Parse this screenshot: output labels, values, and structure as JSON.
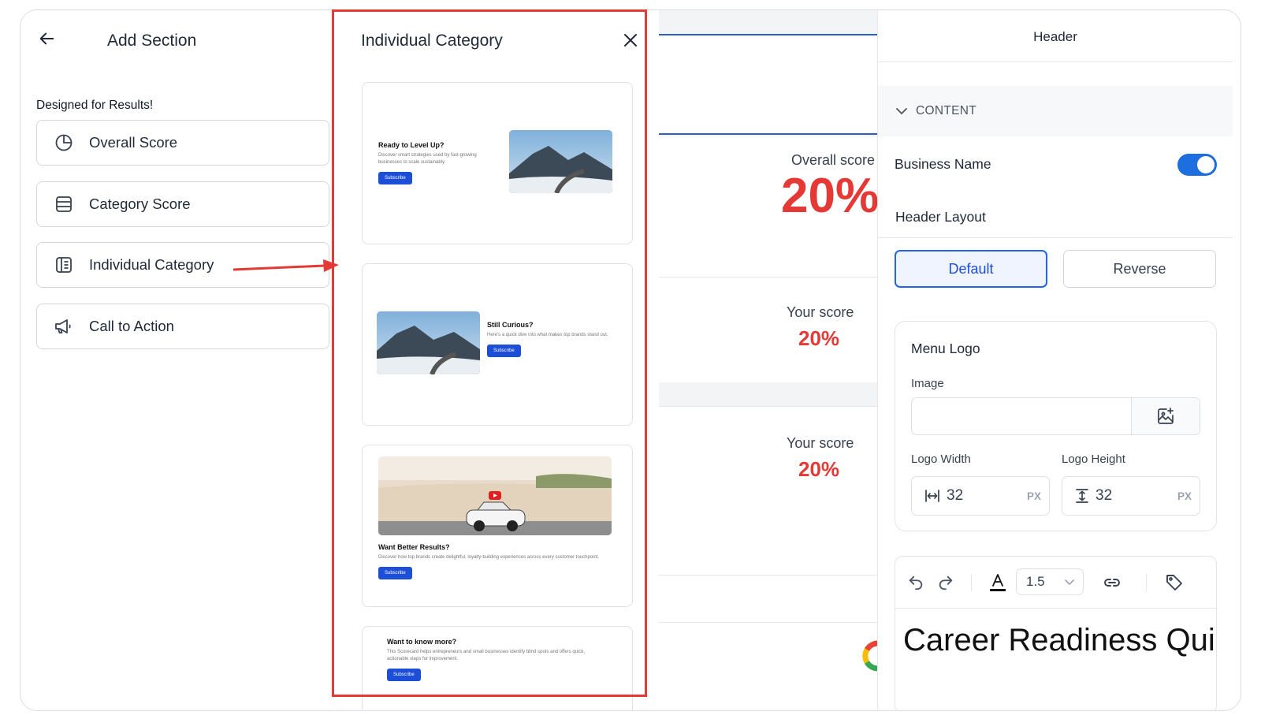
{
  "left_panel": {
    "title": "Add Section",
    "subtitle": "Designed for Results!",
    "items": [
      {
        "label": "Overall Score",
        "icon": "pie-chart-icon"
      },
      {
        "label": "Category Score",
        "icon": "list-icon"
      },
      {
        "label": "Individual Category",
        "icon": "book-icon"
      },
      {
        "label": "Call to Action",
        "icon": "megaphone-icon"
      }
    ]
  },
  "middle_panel": {
    "title": "Individual Category",
    "cards": [
      {
        "heading": "Ready to Level Up?",
        "text": "Discover smart strategies used by fast-growing businesses to scale sustainably.",
        "button": "Subscribe"
      },
      {
        "heading": "Still Curious?",
        "text": "Here's a quick dive into what makes top brands stand out.",
        "button": "Subscribe"
      },
      {
        "heading": "Want Better Results?",
        "text": "Discover how top brands create delightful, loyalty-building experiences across every customer touchpoint.",
        "button": "Subscribe"
      },
      {
        "heading": "Want to know more?",
        "text": "This Scorecard helps entrepreneurs and small businesses identify blind spots and offers quick, actionable steps for improvement.",
        "button": "Subscribe"
      }
    ]
  },
  "preview": {
    "overall_label": "Overall score",
    "overall_value": "20%",
    "scores": [
      {
        "label": "Your score",
        "value": "20%"
      },
      {
        "label": "Your score",
        "value": "20%"
      }
    ]
  },
  "right_panel": {
    "title": "Header",
    "section": "CONTENT",
    "business_name_label": "Business Name",
    "business_name_enabled": true,
    "header_layout_label": "Header Layout",
    "layout_options": [
      "Default",
      "Reverse"
    ],
    "selected_layout": "Default",
    "menu_logo": {
      "title": "Menu Logo",
      "image_label": "Image",
      "width_label": "Logo Width",
      "width_value": "32",
      "height_label": "Logo Height",
      "height_value": "32",
      "unit": "PX"
    },
    "editor": {
      "line_height": "1.5",
      "text": "Career Readiness Quiz"
    }
  },
  "colors": {
    "accent": "#2563eb",
    "highlight": "#e53935"
  }
}
